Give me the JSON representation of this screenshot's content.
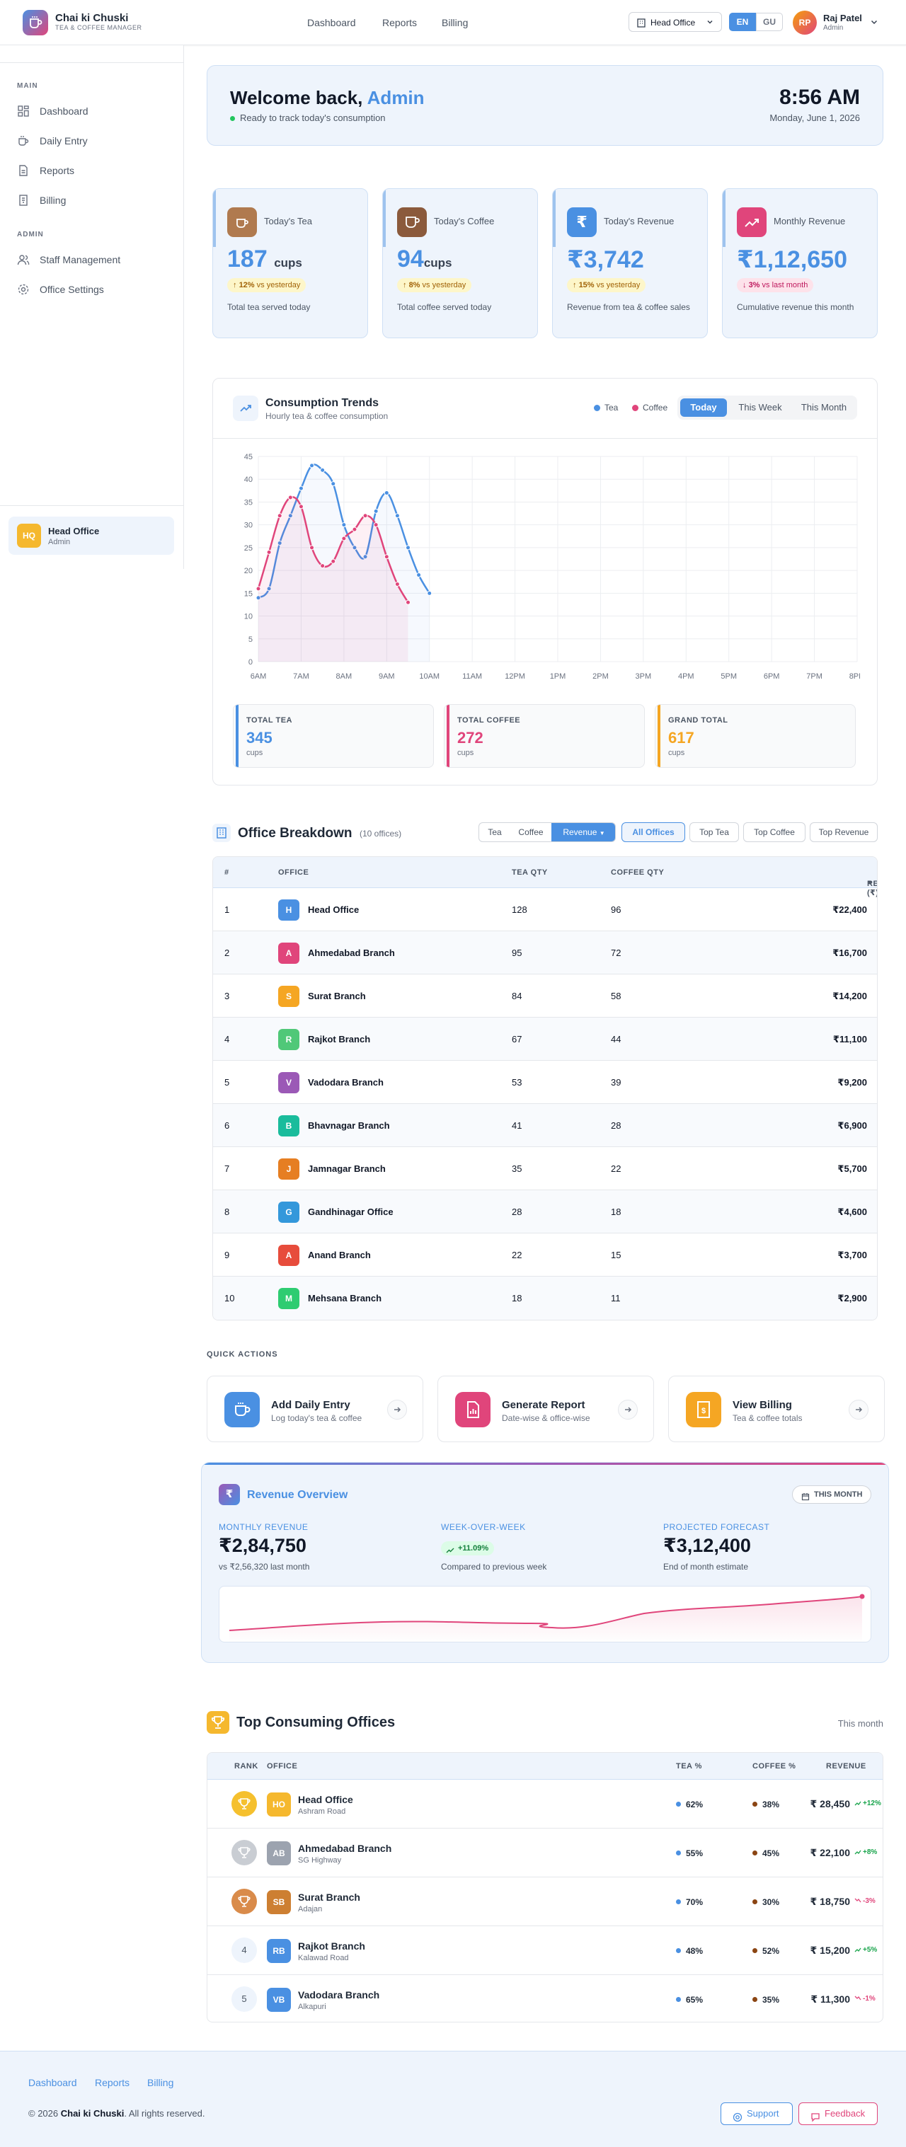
{
  "brand": {
    "name": "Chai ki Chuski",
    "subtitle": "TEA & COFFEE MANAGER"
  },
  "topnav": [
    "Dashboard",
    "Reports",
    "Billing"
  ],
  "office_select": {
    "value": "Head Office"
  },
  "languages": [
    "EN",
    "GU"
  ],
  "active_language": "EN",
  "user": {
    "initials": "RP",
    "name": "Raj Patel",
    "role": "Admin"
  },
  "sidebar": {
    "main_label": "MAIN",
    "main_items": [
      "Dashboard",
      "Daily Entry",
      "Reports",
      "Billing"
    ],
    "admin_label": "ADMIN",
    "admin_items": [
      "Staff Management",
      "Office Settings"
    ],
    "office": {
      "badge": "HQ",
      "name": "Head Office",
      "role": "Admin"
    }
  },
  "welcome": {
    "greeting": "Welcome back,",
    "name": "Admin",
    "status": "Ready to track today's consumption",
    "time": "8:56 AM",
    "date": "Monday, June 1, 2026"
  },
  "stats": [
    {
      "label": "Today's Tea",
      "value": "187",
      "unit": "cups",
      "change_pct": "12%",
      "change_text": "vs yesterday",
      "direction": "up",
      "desc": "Total tea served today",
      "color": "#b07a4f"
    },
    {
      "label": "Today's Coffee",
      "value": "94",
      "unit": "cups",
      "change_pct": "8%",
      "change_text": "vs yesterday",
      "direction": "up",
      "desc": "Total coffee served today",
      "color": "#8b5a3c"
    },
    {
      "label": "Today's Revenue",
      "value": "₹3,742",
      "unit": "",
      "change_pct": "15%",
      "change_text": "vs yesterday",
      "direction": "up",
      "desc": "Revenue from tea & coffee sales",
      "color": "#4a90e2"
    },
    {
      "label": "Monthly Revenue",
      "value": "₹1,12,650",
      "unit": "",
      "change_pct": "3%",
      "change_text": "vs last month",
      "direction": "down",
      "desc": "Cumulative revenue this month",
      "color": "#e0457b"
    }
  ],
  "trends": {
    "title": "Consumption Trends",
    "subtitle": "Hourly tea & coffee consumption",
    "legend": [
      "Tea",
      "Coffee"
    ],
    "periods": [
      "Today",
      "This Week",
      "This Month"
    ],
    "active_period": "Today",
    "totals": [
      {
        "label": "TOTAL TEA",
        "value": "345",
        "unit": "cups",
        "color": "#4a90e2"
      },
      {
        "label": "TOTAL COFFEE",
        "value": "272",
        "unit": "cups",
        "color": "#e0457b"
      },
      {
        "label": "GRAND TOTAL",
        "value": "617",
        "unit": "cups",
        "color": "#f5a623"
      }
    ]
  },
  "chart_data": {
    "type": "line",
    "x_labels": [
      "6AM",
      "7AM",
      "8AM",
      "9AM",
      "10AM",
      "11AM",
      "12PM",
      "1PM",
      "2PM",
      "3PM",
      "4PM",
      "5PM",
      "6PM",
      "7PM",
      "8PM"
    ],
    "y_ticks": [
      0,
      5,
      10,
      15,
      20,
      25,
      30,
      35,
      40,
      45
    ],
    "ylim": [
      0,
      45
    ],
    "x_range": [
      0,
      14
    ],
    "grid": true,
    "series": [
      {
        "name": "Tea",
        "color": "#4a90e2",
        "points": [
          [
            0,
            14
          ],
          [
            0.25,
            16
          ],
          [
            0.5,
            26
          ],
          [
            0.75,
            32
          ],
          [
            1,
            38
          ],
          [
            1.25,
            43
          ],
          [
            1.5,
            42
          ],
          [
            1.75,
            39
          ],
          [
            2,
            30
          ],
          [
            2.25,
            25
          ],
          [
            2.5,
            23
          ],
          [
            2.75,
            33
          ],
          [
            3,
            37
          ],
          [
            3.25,
            32
          ],
          [
            3.5,
            25
          ],
          [
            3.75,
            19
          ],
          [
            4,
            15
          ]
        ]
      },
      {
        "name": "Coffee",
        "color": "#e0457b",
        "points": [
          [
            0,
            16
          ],
          [
            0.25,
            24
          ],
          [
            0.5,
            32
          ],
          [
            0.75,
            36
          ],
          [
            1,
            34
          ],
          [
            1.25,
            25
          ],
          [
            1.5,
            21
          ],
          [
            1.75,
            22
          ],
          [
            2,
            27
          ],
          [
            2.25,
            29
          ],
          [
            2.5,
            32
          ],
          [
            2.75,
            30
          ],
          [
            3,
            23
          ],
          [
            3.25,
            17
          ],
          [
            3.5,
            13
          ]
        ]
      }
    ]
  },
  "breakdown": {
    "title": "Office Breakdown",
    "count": "(10 offices)",
    "metrics": [
      "Tea",
      "Coffee",
      "Revenue"
    ],
    "active_metric": "Revenue",
    "filters": [
      "All Offices",
      "Top Tea",
      "Top Coffee",
      "Top Revenue"
    ],
    "active_filter": "All Offices",
    "columns": [
      "#",
      "OFFICE",
      "TEA QTY",
      "COFFEE QTY",
      "REVENUE (₹)"
    ],
    "rows": [
      {
        "n": "1",
        "initial": "H",
        "name": "Head Office",
        "tea": "128",
        "coffee": "96",
        "revenue": "₹22,400",
        "color": "#4a90e2"
      },
      {
        "n": "2",
        "initial": "A",
        "name": "Ahmedabad Branch",
        "tea": "95",
        "coffee": "72",
        "revenue": "₹16,700",
        "color": "#e0457b"
      },
      {
        "n": "3",
        "initial": "S",
        "name": "Surat Branch",
        "tea": "84",
        "coffee": "58",
        "revenue": "₹14,200",
        "color": "#f5a623"
      },
      {
        "n": "4",
        "initial": "R",
        "name": "Rajkot Branch",
        "tea": "67",
        "coffee": "44",
        "revenue": "₹11,100",
        "color": "#50c878"
      },
      {
        "n": "5",
        "initial": "V",
        "name": "Vadodara Branch",
        "tea": "53",
        "coffee": "39",
        "revenue": "₹9,200",
        "color": "#9b59b6"
      },
      {
        "n": "6",
        "initial": "B",
        "name": "Bhavnagar Branch",
        "tea": "41",
        "coffee": "28",
        "revenue": "₹6,900",
        "color": "#1abc9c"
      },
      {
        "n": "7",
        "initial": "J",
        "name": "Jamnagar Branch",
        "tea": "35",
        "coffee": "22",
        "revenue": "₹5,700",
        "color": "#e67e22"
      },
      {
        "n": "8",
        "initial": "G",
        "name": "Gandhinagar Office",
        "tea": "28",
        "coffee": "18",
        "revenue": "₹4,600",
        "color": "#3498db"
      },
      {
        "n": "9",
        "initial": "A",
        "name": "Anand Branch",
        "tea": "22",
        "coffee": "15",
        "revenue": "₹3,700",
        "color": "#e74c3c"
      },
      {
        "n": "10",
        "initial": "M",
        "name": "Mehsana Branch",
        "tea": "18",
        "coffee": "11",
        "revenue": "₹2,900",
        "color": "#2ecc71"
      }
    ]
  },
  "quick_actions": {
    "label": "QUICK ACTIONS",
    "items": [
      {
        "title": "Add Daily Entry",
        "subtitle": "Log today's tea & coffee",
        "color": "#4a90e2"
      },
      {
        "title": "Generate Report",
        "subtitle": "Date-wise & office-wise",
        "color": "#e0457b"
      },
      {
        "title": "View Billing",
        "subtitle": "Tea & coffee totals",
        "color": "#f5a623"
      }
    ]
  },
  "revenue_overview": {
    "title": "Revenue Overview",
    "period": "THIS MONTH",
    "monthly_label": "MONTHLY REVENUE",
    "monthly_value": "₹2,84,750",
    "monthly_note": "vs ₹2,56,320 last month",
    "wow_label": "WEEK-OVER-WEEK",
    "wow_value": "+11.09%",
    "wow_note": "Compared to previous week",
    "forecast_label": "PROJECTED FORECAST",
    "forecast_value": "₹3,12,400",
    "forecast_note": "End of month estimate",
    "trend_color": "#e0457b"
  },
  "top_offices": {
    "title": "Top Consuming Offices",
    "period": "This month",
    "columns": [
      "RANK",
      "OFFICE",
      "TEA %",
      "COFFEE %",
      "REVENUE"
    ],
    "rows": [
      {
        "rank": "1",
        "medal": "gold",
        "initials": "HO",
        "name": "Head Office",
        "location": "Ashram Road",
        "tea": "62%",
        "coffee": "38%",
        "revenue": "₹ 28,450",
        "change": "+12%",
        "direction": "up",
        "color": "#f5b82e"
      },
      {
        "rank": "2",
        "medal": "silver",
        "initials": "AB",
        "name": "Ahmedabad Branch",
        "location": "SG Highway",
        "tea": "55%",
        "coffee": "45%",
        "revenue": "₹ 22,100",
        "change": "+8%",
        "direction": "up",
        "color": "#9ca3af"
      },
      {
        "rank": "3",
        "medal": "bronze",
        "initials": "SB",
        "name": "Surat Branch",
        "location": "Adajan",
        "tea": "70%",
        "coffee": "30%",
        "revenue": "₹ 18,750",
        "change": "-3%",
        "direction": "down",
        "color": "#cd7f32"
      },
      {
        "rank": "4",
        "medal": "",
        "initials": "RB",
        "name": "Rajkot Branch",
        "location": "Kalawad Road",
        "tea": "48%",
        "coffee": "52%",
        "revenue": "₹ 15,200",
        "change": "+5%",
        "direction": "up",
        "color": "#4a90e2"
      },
      {
        "rank": "5",
        "medal": "",
        "initials": "VB",
        "name": "Vadodara Branch",
        "location": "Alkapuri",
        "tea": "65%",
        "coffee": "35%",
        "revenue": "₹ 11,300",
        "change": "-1%",
        "direction": "down",
        "color": "#4a90e2"
      }
    ]
  },
  "footer": {
    "links": [
      "Dashboard",
      "Reports",
      "Billing"
    ],
    "copyright_prefix": "© 2026",
    "copyright_brand": "Chai ki Chuski",
    "copyright_suffix": ". All rights reserved.",
    "support_label": "Support",
    "feedback_label": "Feedback"
  }
}
